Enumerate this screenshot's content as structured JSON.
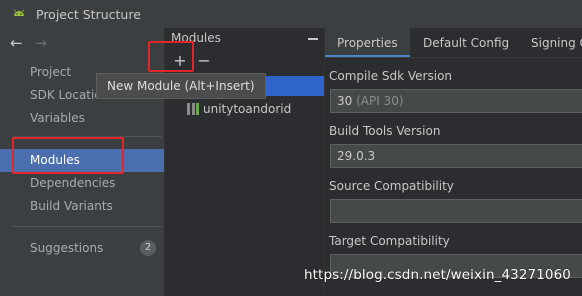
{
  "window": {
    "title": "Project Structure"
  },
  "nav": {
    "items": [
      {
        "label": "Project"
      },
      {
        "label": "SDK Location"
      },
      {
        "label": "Variables"
      },
      {
        "label": "Modules"
      },
      {
        "label": "Dependencies"
      },
      {
        "label": "Build Variants"
      }
    ],
    "suggestions": {
      "label": "Suggestions",
      "count": "2"
    }
  },
  "modules_panel": {
    "header": "Modules",
    "tooltip": "New Module (Alt+Insert)",
    "module_name": "unitytoandorid"
  },
  "properties": {
    "tabs": [
      "Properties",
      "Default Config",
      "Signing C"
    ],
    "compile_sdk": {
      "label": "Compile Sdk Version",
      "value": "30",
      "hint": "(API 30)"
    },
    "build_tools": {
      "label": "Build Tools Version",
      "value": "29.0.3"
    },
    "source_compat": {
      "label": "Source Compatibility",
      "value": ""
    },
    "target_compat": {
      "label": "Target Compatibility",
      "value": ""
    }
  },
  "watermark": "https://blog.csdn.net/weixin_43271060",
  "colors": {
    "selection": "#4b6eaf",
    "highlight_box": "#e0262a",
    "tab_underline": "#4a88c7"
  }
}
